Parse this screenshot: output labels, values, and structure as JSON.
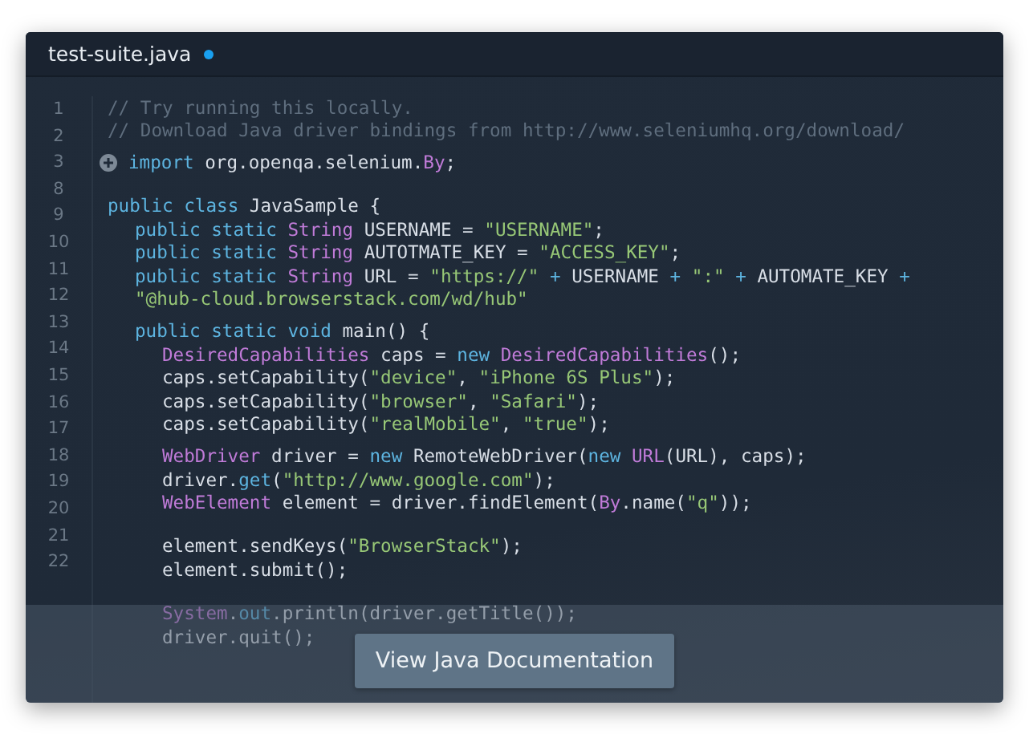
{
  "editor": {
    "tab": {
      "title": "test-suite.java",
      "modified": true
    },
    "gutter": [
      "1",
      "2",
      "3",
      "8",
      "9",
      "10",
      "11",
      "12",
      "13",
      "14",
      "15",
      "16",
      "17",
      "18",
      "19",
      "20",
      "21",
      "22"
    ],
    "lines": [
      {
        "tokens": [
          {
            "kind": "comment",
            "text": "// Try running this locally."
          }
        ]
      },
      {
        "tokens": [
          {
            "kind": "comment",
            "text": "// Download Java driver bindings from http://www.seleniumhq.org/download/"
          }
        ]
      },
      {
        "expander": true,
        "gap_before": true,
        "tokens": [
          {
            "kind": "keyword",
            "text": "import"
          },
          {
            "kind": "plain",
            "text": " org.openqa.selenium."
          },
          {
            "kind": "type",
            "text": "By"
          },
          {
            "kind": "plain",
            "text": ";"
          }
        ]
      },
      {
        "kind": "blank"
      },
      {
        "tokens": [
          {
            "kind": "keyword",
            "text": "public class"
          },
          {
            "kind": "plain",
            "text": " JavaSample {"
          }
        ],
        "children": [
          {
            "tokens": [
              {
                "kind": "keyword",
                "text": "public static "
              },
              {
                "kind": "type",
                "text": "String"
              },
              {
                "kind": "plain",
                "text": " USERNAME = "
              },
              {
                "kind": "string",
                "text": "\"USERNAME\""
              },
              {
                "kind": "plain",
                "text": ";"
              }
            ]
          },
          {
            "tokens": [
              {
                "kind": "keyword",
                "text": "public static "
              },
              {
                "kind": "type",
                "text": "String"
              },
              {
                "kind": "plain",
                "text": " AUTOTMATE_KEY = "
              },
              {
                "kind": "string",
                "text": "\"ACCESS_KEY\""
              },
              {
                "kind": "plain",
                "text": ";"
              }
            ]
          },
          {
            "tokens": [
              {
                "kind": "keyword",
                "text": "public static "
              },
              {
                "kind": "type",
                "text": "String"
              },
              {
                "kind": "plain",
                "text": " URL = "
              },
              {
                "kind": "string",
                "text": "\"https://\""
              },
              {
                "kind": "keyword",
                "text": " + "
              },
              {
                "kind": "plain",
                "text": "USERNAME"
              },
              {
                "kind": "keyword",
                "text": " + "
              },
              {
                "kind": "string",
                "text": "\":\""
              },
              {
                "kind": "keyword",
                "text": " + "
              },
              {
                "kind": "plain",
                "text": "AUTOMATE_KEY"
              },
              {
                "kind": "keyword",
                "text": " +"
              }
            ]
          },
          {
            "tokens": [
              {
                "kind": "string",
                "text": "\"@hub-cloud.browserstack.com/wd/hub\""
              }
            ]
          },
          {
            "gap_before": true,
            "tokens": [
              {
                "kind": "keyword",
                "text": "public static void"
              },
              {
                "kind": "plain",
                "text": " main() {"
              }
            ],
            "children": [
              {
                "tokens": [
                  {
                    "kind": "type",
                    "text": "DesiredCapabilities"
                  },
                  {
                    "kind": "plain",
                    "text": " caps = "
                  },
                  {
                    "kind": "keyword",
                    "text": "new "
                  },
                  {
                    "kind": "type",
                    "text": "DesiredCapabilities"
                  },
                  {
                    "kind": "plain",
                    "text": "();"
                  }
                ]
              },
              {
                "tokens": [
                  {
                    "kind": "plain",
                    "text": "caps.setCapability("
                  },
                  {
                    "kind": "string",
                    "text": "\"device\""
                  },
                  {
                    "kind": "plain",
                    "text": ", "
                  },
                  {
                    "kind": "string",
                    "text": "\"iPhone 6S Plus\""
                  },
                  {
                    "kind": "plain",
                    "text": ");"
                  }
                ]
              },
              {
                "tokens": [
                  {
                    "kind": "plain",
                    "text": "caps.setCapability("
                  },
                  {
                    "kind": "string",
                    "text": "\"browser\""
                  },
                  {
                    "kind": "plain",
                    "text": ", "
                  },
                  {
                    "kind": "string",
                    "text": "\"Safari\""
                  },
                  {
                    "kind": "plain",
                    "text": ");"
                  }
                ]
              },
              {
                "tokens": [
                  {
                    "kind": "plain",
                    "text": "caps.setCapability("
                  },
                  {
                    "kind": "string",
                    "text": "\"realMobile\""
                  },
                  {
                    "kind": "plain",
                    "text": ", "
                  },
                  {
                    "kind": "string",
                    "text": "\"true\""
                  },
                  {
                    "kind": "plain",
                    "text": ");"
                  }
                ]
              },
              {
                "gap_before": true,
                "tokens": [
                  {
                    "kind": "type",
                    "text": "WebDriver"
                  },
                  {
                    "kind": "plain",
                    "text": " driver = "
                  },
                  {
                    "kind": "keyword",
                    "text": "new"
                  },
                  {
                    "kind": "plain",
                    "text": " RemoteWebDriver("
                  },
                  {
                    "kind": "keyword",
                    "text": "new "
                  },
                  {
                    "kind": "type",
                    "text": "URL"
                  },
                  {
                    "kind": "plain",
                    "text": "(URL), caps);"
                  }
                ]
              },
              {
                "tokens": [
                  {
                    "kind": "plain",
                    "text": "driver."
                  },
                  {
                    "kind": "keyword",
                    "text": "get"
                  },
                  {
                    "kind": "plain",
                    "text": "("
                  },
                  {
                    "kind": "string",
                    "text": "\"http://www.google.com\""
                  },
                  {
                    "kind": "plain",
                    "text": ");"
                  }
                ]
              },
              {
                "tokens": [
                  {
                    "kind": "type",
                    "text": "WebElement"
                  },
                  {
                    "kind": "plain",
                    "text": " element = driver.findElement("
                  },
                  {
                    "kind": "type",
                    "text": "By"
                  },
                  {
                    "kind": "plain",
                    "text": ".name("
                  },
                  {
                    "kind": "string",
                    "text": "\"q\""
                  },
                  {
                    "kind": "plain",
                    "text": "));"
                  }
                ]
              },
              {
                "kind": "blank"
              },
              {
                "tokens": [
                  {
                    "kind": "plain",
                    "text": "element.sendKeys("
                  },
                  {
                    "kind": "string",
                    "text": "\"BrowserStack\""
                  },
                  {
                    "kind": "plain",
                    "text": ");"
                  }
                ]
              },
              {
                "tokens": [
                  {
                    "kind": "plain",
                    "text": "element.submit();"
                  }
                ]
              },
              {
                "kind": "blank"
              },
              {
                "tokens": [
                  {
                    "kind": "type",
                    "text": "System"
                  },
                  {
                    "kind": "plain",
                    "text": "."
                  },
                  {
                    "kind": "keyword",
                    "text": "out"
                  },
                  {
                    "kind": "plain",
                    "text": ".println(driver.getTitle());"
                  }
                ]
              },
              {
                "tokens": [
                  {
                    "kind": "plain",
                    "text": "driver.quit();"
                  }
                ]
              }
            ]
          }
        ]
      }
    ]
  },
  "overlay": {
    "button": "View Java Documentation"
  }
}
